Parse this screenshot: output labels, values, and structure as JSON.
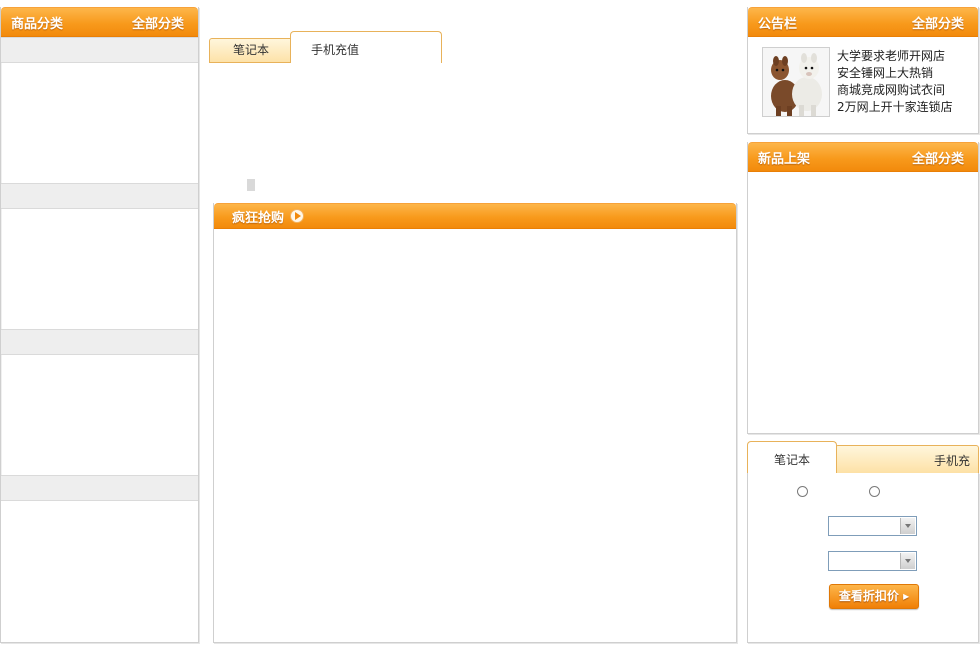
{
  "left_panel": {
    "title": "商品分类",
    "more_link": "全部分类"
  },
  "mid_tabs": [
    {
      "label": "笔记本"
    },
    {
      "label": "手机充值"
    }
  ],
  "flash_sale": {
    "title": "疯狂抢购",
    "icon": "play-arrow-icon"
  },
  "notice_board": {
    "title": "公告栏",
    "more_link": "全部分类",
    "items": [
      "大学要求老师开网店",
      "安全锤网上大热销",
      "商城竞成网购试衣间",
      "2万网上开十家连锁店"
    ]
  },
  "new_arrivals": {
    "title": "新品上架",
    "more_link": "全部分类"
  },
  "bottom_tabs": [
    {
      "label": "笔记本"
    },
    {
      "label": "手机充值"
    }
  ],
  "discount_button": "查看折扣价",
  "colors": {
    "accent_orange": "#f89a1c",
    "tab_border": "#e8b25a",
    "panel_border": "#cfcfcf"
  }
}
